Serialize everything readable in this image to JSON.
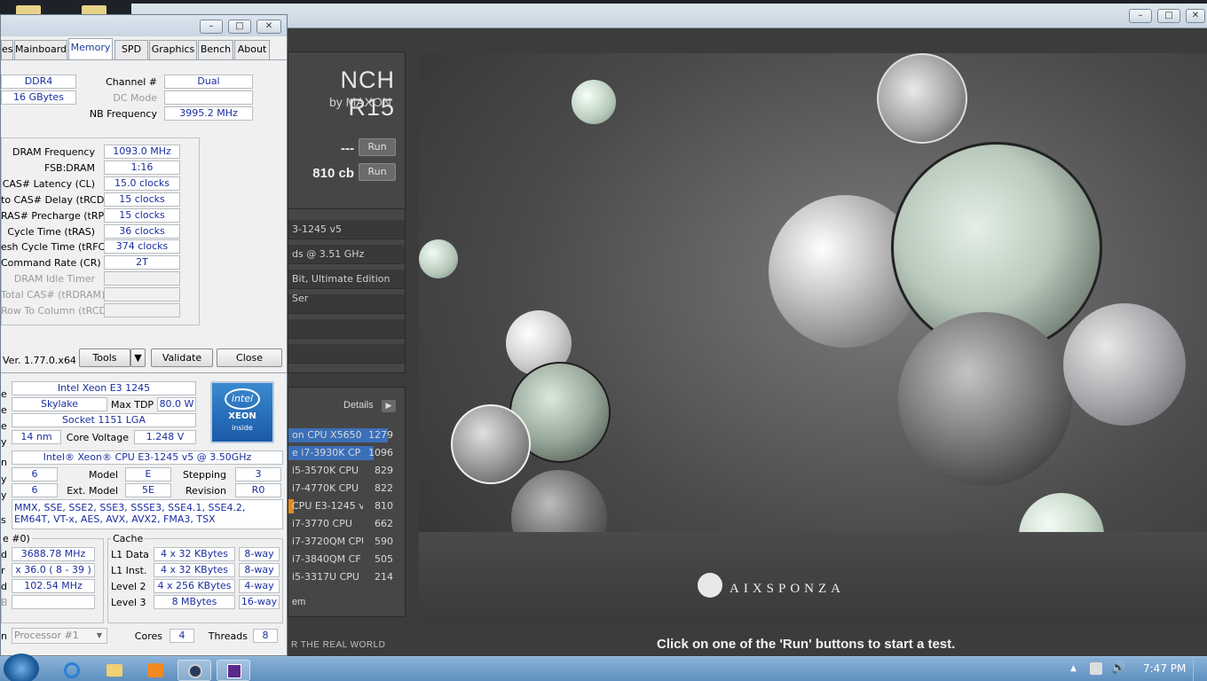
{
  "cinebench": {
    "logo_title": "NCH R15",
    "logo_sub": "by MAXON",
    "tests": [
      {
        "score": "---",
        "run_label": "Run"
      },
      {
        "score": "810 cb",
        "run_label": "Run"
      }
    ],
    "system_info": [
      "3-1245 v5",
      "ds @ 3.51 GHz",
      "Bit, Ultimate Edition Ser",
      "",
      "",
      ""
    ],
    "ranking_header": "Details",
    "ranking": [
      {
        "name": "on CPU X5650",
        "score": "1279",
        "bar_fraction": 1.0,
        "color": "#3b6fb8"
      },
      {
        "name": "e i7-3930K CP",
        "score": "1096",
        "bar_fraction": 0.86,
        "color": "#3b6fb8"
      },
      {
        "name": "i5-3570K CPU",
        "score": "829",
        "bar_fraction": 0.0,
        "color": ""
      },
      {
        "name": "i7-4770K CPU",
        "score": "822",
        "bar_fraction": 0.0,
        "color": ""
      },
      {
        "name": "CPU E3-1245 v",
        "score": "810",
        "bar_fraction": 0.05,
        "color": "#e08a1e"
      },
      {
        "name": "i7-3770 CPU",
        "score": "662",
        "bar_fraction": 0.0,
        "color": ""
      },
      {
        "name": "i7-3720QM CPU",
        "score": "590",
        "bar_fraction": 0.0,
        "color": ""
      },
      {
        "name": "i7-3840QM CF",
        "score": "505",
        "bar_fraction": 0.0,
        "color": ""
      },
      {
        "name": "i5-3317U CPU",
        "score": "214",
        "bar_fraction": 0.0,
        "color": ""
      }
    ],
    "ranking_footer": "em",
    "footer_tagline": "R THE REAL WORLD",
    "status_message": "Click on one of the 'Run' buttons to start a test.",
    "render_logo": "AIXSPONZA"
  },
  "cpuz": {
    "tabs": [
      "es",
      "Mainboard",
      "Memory",
      "SPD",
      "Graphics",
      "Bench",
      "About"
    ],
    "active_tab": "Memory",
    "memory": {
      "type": "DDR4",
      "size": "16 GBytes",
      "channel_label": "Channel #",
      "channel": "Dual",
      "dc_mode_label": "DC Mode",
      "dc_mode": "",
      "nb_freq_label": "NB Frequency",
      "nb_freq": "3995.2 MHz"
    },
    "timings": [
      {
        "label": "DRAM Frequency",
        "value": "1093.0 MHz",
        "disabled": false
      },
      {
        "label": "FSB:DRAM",
        "value": "1:16",
        "disabled": false
      },
      {
        "label": "CAS# Latency (CL)",
        "value": "15.0 clocks",
        "disabled": false
      },
      {
        "label": "to CAS# Delay (tRCD)",
        "value": "15 clocks",
        "disabled": false
      },
      {
        "label": "RAS# Precharge (tRP)",
        "value": "15 clocks",
        "disabled": false
      },
      {
        "label": "Cycle Time (tRAS)",
        "value": "36 clocks",
        "disabled": false
      },
      {
        "label": "esh Cycle Time (tRFC)",
        "value": "374 clocks",
        "disabled": false
      },
      {
        "label": "Command Rate (CR)",
        "value": "2T",
        "disabled": false
      },
      {
        "label": "DRAM Idle Timer",
        "value": "",
        "disabled": true
      },
      {
        "label": "Total CAS# (tRDRAM)",
        "value": "",
        "disabled": true
      },
      {
        "label": "Row To Column (tRCD)",
        "value": "",
        "disabled": true
      }
    ],
    "version": "Ver. 1.77.0.x64",
    "tools_label": "Tools",
    "validate_label": "Validate",
    "close_label": "Close",
    "cpu": {
      "name": "Intel Xeon E3 1245",
      "codename": "Skylake",
      "max_tdp_label": "Max TDP",
      "max_tdp": "80.0 W",
      "package": "Socket 1151 LGA",
      "technology": "14 nm",
      "core_voltage_label": "Core Voltage",
      "core_voltage": "1.248 V",
      "spec": "Intel® Xeon® CPU E3-1245 v5 @ 3.50GHz",
      "family": "6",
      "model_label": "Model",
      "model": "E",
      "stepping_label": "Stepping",
      "stepping": "3",
      "ext_family": "6",
      "ext_model_label": "Ext. Model",
      "ext_model": "5E",
      "revision_label": "Revision",
      "revision": "R0",
      "instructions": "MMX, SSE, SSE2, SSE3, SSSE3, SSE4.1, SSE4.2, EM64T, VT-x, AES, AVX, AVX2, FMA3, TSX",
      "row_labels": [
        "e",
        "e",
        "e",
        "y",
        "n",
        "y",
        "y",
        "s"
      ]
    },
    "clocks": {
      "group_label": "e #0)",
      "core_speed": "3688.78 MHz",
      "multiplier": "x 36.0 ( 8 - 39 )",
      "bus_speed": "102.54 MHz",
      "rated_fsb": "",
      "row_labels": [
        "d",
        "r",
        "d",
        "B"
      ]
    },
    "cache": {
      "group_label": "Cache",
      "rows": [
        {
          "label": "L1 Data",
          "size": "4 x 32 KBytes",
          "way": "8-way"
        },
        {
          "label": "L1 Inst.",
          "size": "4 x 32 KBytes",
          "way": "8-way"
        },
        {
          "label": "Level 2",
          "size": "4 x 256 KBytes",
          "way": "4-way"
        },
        {
          "label": "Level 3",
          "size": "8 MBytes",
          "way": "16-way"
        }
      ]
    },
    "selection": "Processor #1",
    "cores_label": "Cores",
    "cores": "4",
    "threads_label": "Threads",
    "threads": "8",
    "intel_badge": {
      "brand": "intel",
      "line": "XEON",
      "sub": "inside"
    }
  },
  "taskbar": {
    "clock": "7:47 PM"
  }
}
